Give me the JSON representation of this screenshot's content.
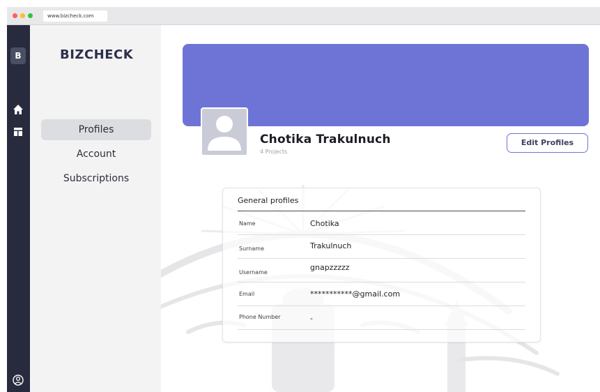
{
  "browser": {
    "url": "www.bizcheck.com",
    "dot_colors": [
      "#ff5f57",
      "#febc2e",
      "#28c840"
    ]
  },
  "rail": {
    "logo_letter": "B",
    "icons": [
      "home-icon",
      "dashboard-icon",
      "user-circle-icon"
    ]
  },
  "sidebar": {
    "brand": "BIZCHECK",
    "items": [
      {
        "label": "Profiles",
        "active": true
      },
      {
        "label": "Account",
        "active": false
      },
      {
        "label": "Subscriptions",
        "active": false
      }
    ]
  },
  "profile": {
    "banner_color": "#6e74d6",
    "name": "Chotika Trakulnuch",
    "projects": "4 Projects",
    "edit_label": "Edit Profiles"
  },
  "general": {
    "title": "General profiles",
    "rows": [
      {
        "label": "Name",
        "value": "Chotika"
      },
      {
        "label": "Surname",
        "value": "Trakulnuch"
      },
      {
        "label": "Username",
        "value": "gnapzzzzz"
      },
      {
        "label": "Email",
        "value": "***********@gmail.com"
      },
      {
        "label": "Phone Number",
        "value": "-"
      }
    ]
  }
}
